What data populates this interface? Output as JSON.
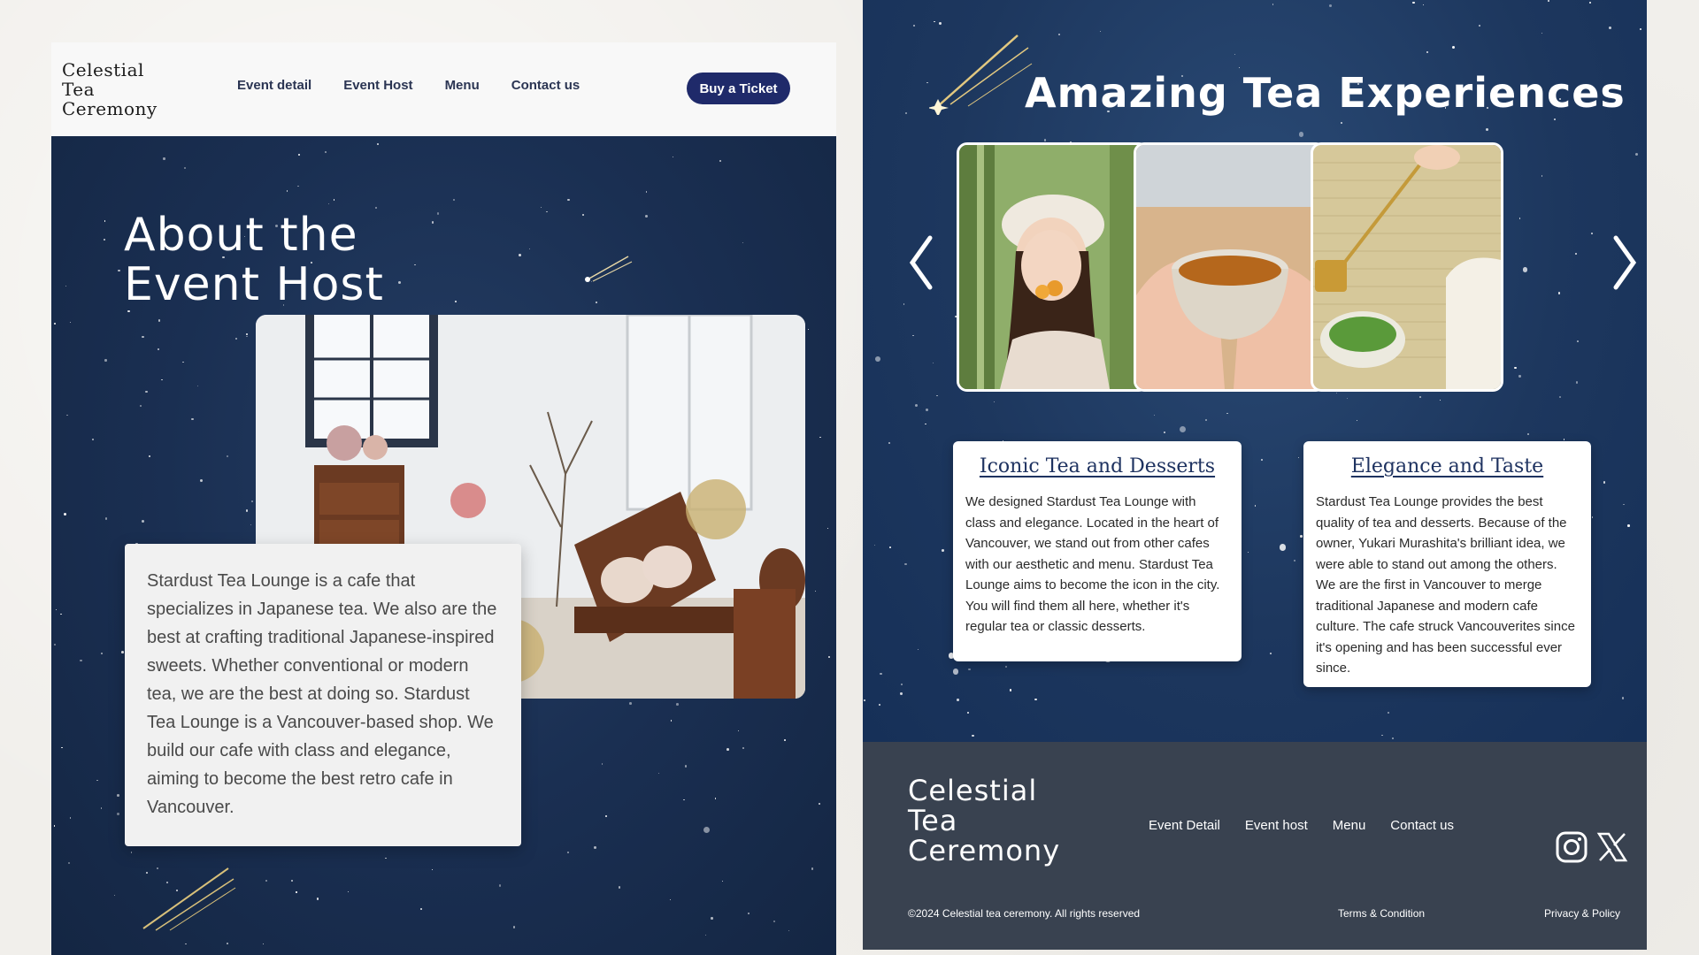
{
  "brand": {
    "logo_lines": [
      "Celestial",
      "Tea",
      "Ceremony"
    ]
  },
  "nav": {
    "links": [
      "Event detail",
      "Event Host",
      "Menu",
      "Contact us"
    ],
    "cta": "Buy a Ticket"
  },
  "host": {
    "title_lines": [
      "About the",
      "Event Host"
    ],
    "body": "Stardust Tea Lounge is a cafe that specializes in Japanese tea. We also are the best at crafting traditional Japanese-inspired sweets. Whether conventional or modern tea, we are the best at doing so. Stardust Tea Lounge is a Vancouver-based shop. We build our cafe with class and elegance, aiming to become the best retro cafe in Vancouver."
  },
  "experiences": {
    "title": "Amazing Tea Experiences",
    "cards": [
      {
        "title": "Iconic Tea and Desserts",
        "body": "We designed Stardust Tea Lounge with class and elegance. Located in the heart of Vancouver, we stand out from other cafes with our aesthetic and menu. Stardust Tea Lounge aims to become the icon in the city. You will find them all here, whether it's regular tea or classic desserts."
      },
      {
        "title": "Elegance and Taste",
        "body": "Stardust Tea Lounge provides the best quality of tea and desserts. Because of the owner, Yukari Murashita's brilliant idea, we were able to stand out among the others. We are the first in Vancouver to merge traditional Japanese and modern cafe culture. The cafe struck Vancouverites since it's opening and has been successful ever since."
      }
    ]
  },
  "footer": {
    "links": [
      "Event Detail",
      "Event host",
      "Menu",
      "Contact us"
    ],
    "copyright": "©2024 Celestial tea ceremony. All rights reserved",
    "terms": "Terms & Condition",
    "privacy": "Privacy & Policy"
  },
  "colors": {
    "navy": "#1a2f52",
    "button": "#1f2a6a",
    "footer": "#394250"
  }
}
